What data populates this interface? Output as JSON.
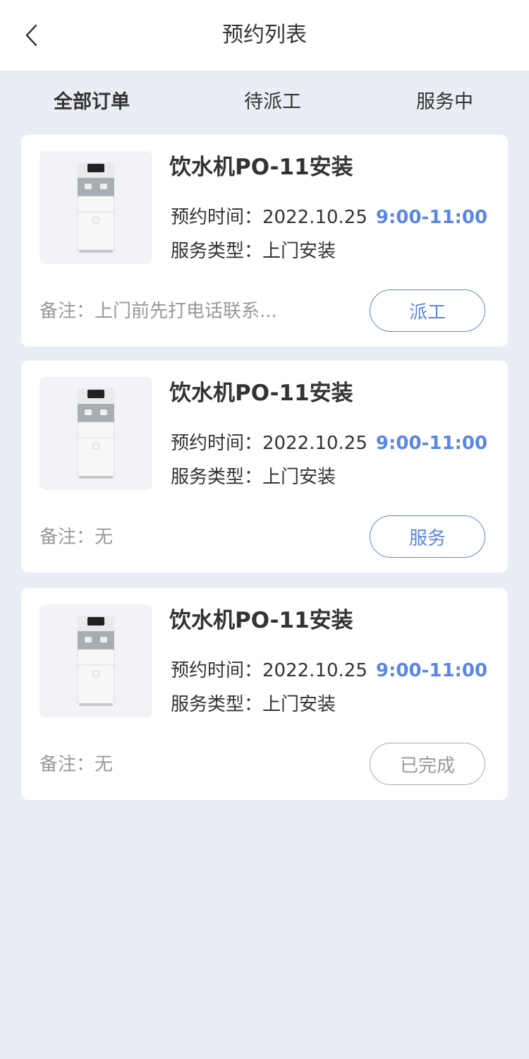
{
  "header": {
    "title": "预约列表",
    "back_icon": "chevron-left-icon"
  },
  "tabs": [
    {
      "label": "全部订单",
      "active": true
    },
    {
      "label": "待派工",
      "active": false
    },
    {
      "label": "服务中",
      "active": false
    }
  ],
  "colors": {
    "accent": "#5B87E0",
    "background": "#EAEDF4",
    "muted": "#999999"
  },
  "orders": [
    {
      "title": "饮水机PO-11安装",
      "time_label": "预约时间：",
      "date": "2022.10.25",
      "time_range": "9:00-11:00",
      "type_label": "服务类型：",
      "type_value": "上门安装",
      "remark": "备注：上门前先打电话联系...",
      "action": "派工",
      "action_state": "active"
    },
    {
      "title": "饮水机PO-11安装",
      "time_label": "预约时间：",
      "date": "2022.10.25",
      "time_range": "9:00-11:00",
      "type_label": "服务类型：",
      "type_value": "上门安装",
      "remark": "备注：无",
      "action": "服务",
      "action_state": "active"
    },
    {
      "title": "饮水机PO-11安装",
      "time_label": "预约时间：",
      "date": "2022.10.25",
      "time_range": "9:00-11:00",
      "type_label": "服务类型：",
      "type_value": "上门安装",
      "remark": "备注：无",
      "action": "已完成",
      "action_state": "done"
    }
  ]
}
